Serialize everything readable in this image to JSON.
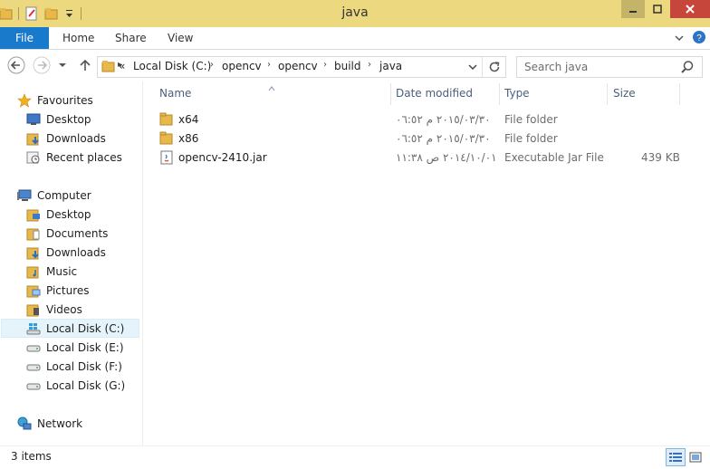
{
  "window": {
    "title": "java",
    "colors": {
      "title_bar": "#ecd97f",
      "file_tab": "#1979ca",
      "close_button": "#c7463c",
      "selection": "#e5f3fb"
    }
  },
  "ribbon": {
    "file_label": "File",
    "tabs": [
      "Home",
      "Share",
      "View"
    ]
  },
  "address": {
    "overflow": "«",
    "crumbs": [
      "Local Disk (C:)",
      "opencv",
      "opencv",
      "build",
      "java"
    ],
    "search_placeholder": "Search java"
  },
  "nav": {
    "favourites": {
      "label": "Favourites",
      "items": [
        "Desktop",
        "Downloads",
        "Recent places"
      ]
    },
    "computer": {
      "label": "Computer",
      "items": [
        "Desktop",
        "Documents",
        "Downloads",
        "Music",
        "Pictures",
        "Videos",
        "Local Disk (C:)",
        "Local Disk (E:)",
        "Local Disk (F:)",
        "Local Disk (G:)"
      ],
      "selected": "Local Disk (C:)"
    },
    "network": {
      "label": "Network"
    }
  },
  "columns": [
    "Name",
    "Date modified",
    "Type",
    "Size"
  ],
  "files": [
    {
      "name": "x64",
      "date": "٢٠١٥/٠٣/٣٠ م ٠٦:٥٢",
      "type": "File folder",
      "size": "",
      "icon": "folder-icon"
    },
    {
      "name": "x86",
      "date": "٢٠١٥/٠٣/٣٠ م ٠٦:٥٢",
      "type": "File folder",
      "size": "",
      "icon": "folder-icon"
    },
    {
      "name": "opencv-2410.jar",
      "date": "٢٠١٤/١٠/٠١ ص ١١:٣٨",
      "type": "Executable Jar File",
      "size": "439 KB",
      "icon": "jar-file-icon"
    }
  ],
  "status": {
    "items_count": "3 items"
  }
}
